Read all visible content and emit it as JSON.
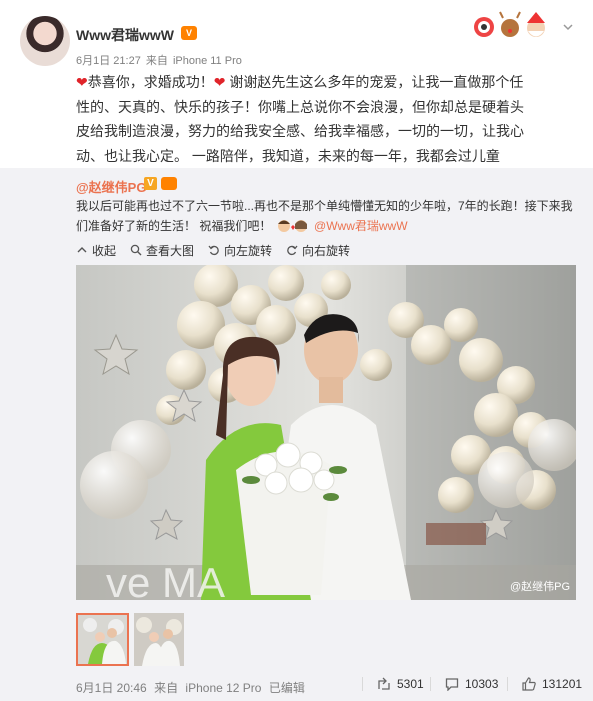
{
  "post": {
    "username": "Www君瑞wwW",
    "date": "6月1日 21:27",
    "source_prefix": "来自",
    "device": "iPhone 11 Pro",
    "text_parts": [
      "恭喜你，求婚成功！",
      "谢谢赵先生这么多年的宠爱，让我一直做那个任性的、天真的、快乐的孩子！你嘴上总说你不会浪漫，但你却总是硬着头皮给我制造浪漫，努力的给我安全感、给我幸福感，一切的一切，让我心动、也让我心定。 一路陪伴，我知道，未来的每一年，我都会过儿童节，对吗？！"
    ]
  },
  "repost": {
    "author": "@赵继伟PG",
    "v_label": "V",
    "text_parts": [
      "我以后可能再也过不了六一节啦...再也不是那个单纯懵懂无知的少年啦，7年的长跑！接下来我们准备好了新的生活！ 祝福我们吧！",
      "@Www君瑞wwW"
    ],
    "toolbar": {
      "collapse": "收起",
      "view_large": "查看大图",
      "rotate_left": "向左旋转",
      "rotate_right": "向右旋转"
    },
    "watermark": "@赵继伟PG",
    "footer": {
      "date": "6月1日 20:46",
      "source_prefix": "来自",
      "device": "iPhone 12 Pro",
      "edited": "已编辑",
      "reposts": "5301",
      "comments": "10303",
      "likes": "131201"
    }
  }
}
